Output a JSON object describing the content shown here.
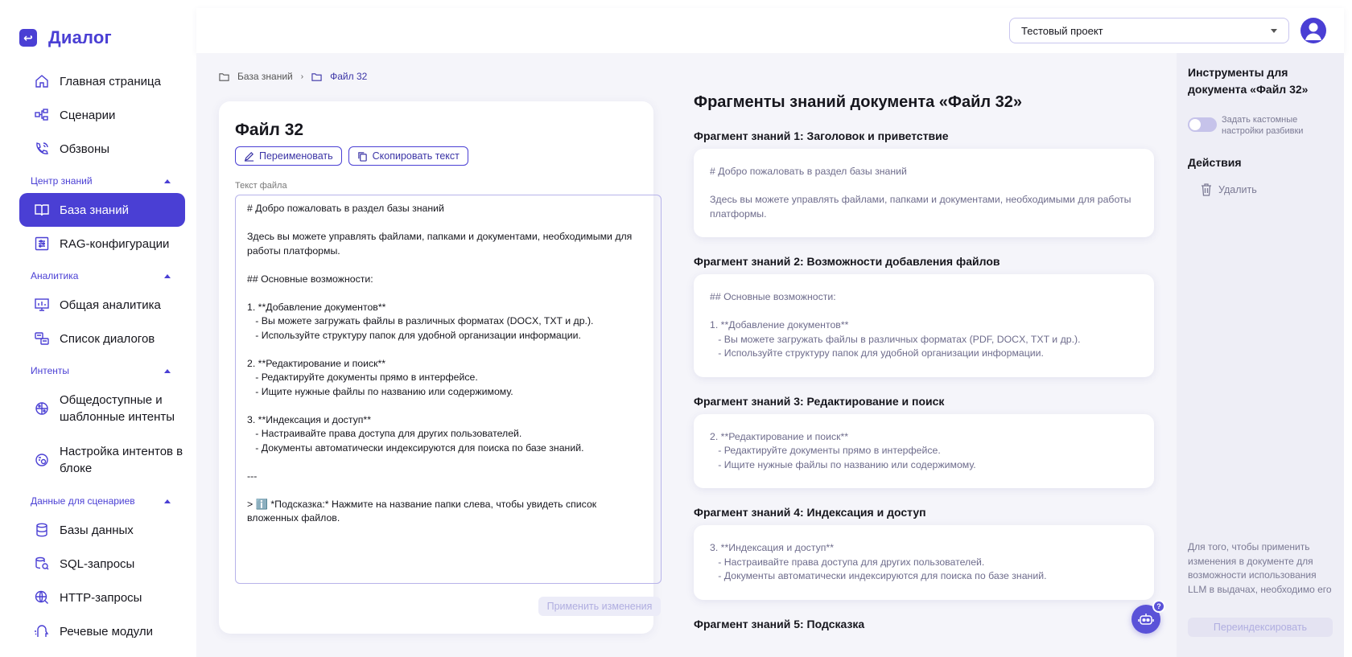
{
  "brand": {
    "name": "Диалог"
  },
  "nav": {
    "main": [
      {
        "label": "Главная страница",
        "icon": "home-icon"
      },
      {
        "label": "Сценарии",
        "icon": "scenarios-icon"
      },
      {
        "label": "Обзвоны",
        "icon": "phone-icon"
      }
    ],
    "sections": [
      {
        "label": "Центр знаний",
        "items": [
          {
            "label": "База знаний",
            "icon": "book-icon",
            "active": true
          },
          {
            "label": "RAG-конфигурации",
            "icon": "sliders-icon"
          }
        ]
      },
      {
        "label": "Аналитика",
        "items": [
          {
            "label": "Общая аналитика",
            "icon": "chart-icon"
          },
          {
            "label": "Список диалогов",
            "icon": "dialog-list-icon"
          }
        ]
      },
      {
        "label": "Интенты",
        "items": [
          {
            "label": "Общедоступные и шаблонные интенты",
            "icon": "brain-icon"
          },
          {
            "label": "Настройка интентов в блоке",
            "icon": "brain-gear-icon"
          }
        ]
      },
      {
        "label": "Данные для сценариев",
        "items": [
          {
            "label": "Базы данных",
            "icon": "database-icon"
          },
          {
            "label": "SQL-запросы",
            "icon": "sql-icon"
          },
          {
            "label": "HTTP-запросы",
            "icon": "http-icon"
          },
          {
            "label": "Речевые модули",
            "icon": "speech-icon"
          }
        ]
      }
    ]
  },
  "topbar": {
    "project": "Тестовый проект"
  },
  "breadcrumb": {
    "root": "База знаний",
    "current": "Файл 32"
  },
  "editor": {
    "title": "Файл 32",
    "rename_label": "Переименовать",
    "copy_label": "Скопировать текст",
    "field_label": "Текст файла",
    "text": "# Добро пожаловать в раздел базы знаний\n\nЗдесь вы можете управлять файлами, папками и документами, необходимыми для\nработы платформы.\n\n## Основные возможности:\n\n1. **Добавление документов**\n   - Вы можете загружать файлы в различных форматах (DOCX, TXT и др.).\n   - Используйте структуру папок для удобной организации информации.\n\n2. **Редактирование и поиск**\n   - Редактируйте документы прямо в интерфейсе.\n   - Ищите нужные файлы по названию или содержимому.\n\n3. **Индексация и доступ**\n   - Настраивайте права доступа для других пользователей.\n   - Документы автоматически индексируются для поиска по базе знаний.\n\n---\n\n> ℹ️ *Подсказка:* Нажмите на название папки слева, чтобы увидеть список\nвложенных файлов.",
    "apply_label": "Применить изменения"
  },
  "fragments": {
    "heading": "Фрагменты знаний документа «Файл 32»",
    "items": [
      {
        "title": "Фрагмент знаний 1: Заголовок и приветствие",
        "text": "# Добро пожаловать в раздел базы знаний\n\nЗдесь вы можете управлять файлами, папками и документами, необходимыми для работы\nплатформы."
      },
      {
        "title": "Фрагмент знаний 2: Возможности добавления файлов",
        "text": "## Основные возможности:\n\n1. **Добавление документов**\n   - Вы можете загружать файлы в различных форматах (PDF, DOCX, TXT и др.).\n   - Используйте структуру папок для удобной организации информации."
      },
      {
        "title": "Фрагмент знаний 3: Редактирование и поиск",
        "text": "2. **Редактирование и поиск**\n   - Редактируйте документы прямо в интерфейсе.\n   - Ищите нужные файлы по названию или содержимому."
      },
      {
        "title": "Фрагмент знаний 4: Индексация и доступ",
        "text": "3. **Индексация и доступ**\n   - Настраивайте права доступа для других пользователей.\n   - Документы автоматически индексируются для поиска по базе знаний."
      },
      {
        "title": "Фрагмент знаний 5: Подсказка",
        "text": ""
      }
    ]
  },
  "tools": {
    "title": "Инструменты для документа «Файл 32»",
    "toggle_label": "Задать кастомные настройки разбивки",
    "actions_title": "Действия",
    "delete_label": "Удалить",
    "note": "Для того, чтобы применить изменения в документе для возможности использования LLM в выдачах, необходимо его",
    "reindex_label": "Переиндексировать"
  },
  "help": {
    "badge": "?"
  },
  "colors": {
    "accent": "#4a3fd4",
    "background": "#f5f5fa"
  }
}
